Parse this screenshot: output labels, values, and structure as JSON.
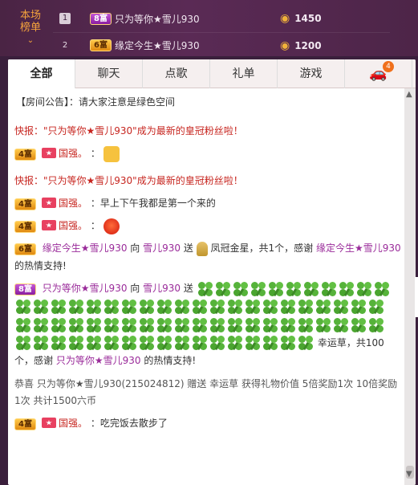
{
  "ranking": {
    "label_line1": "本场",
    "label_line2": "榜单",
    "rows": [
      {
        "rank": "1",
        "badge": "8富",
        "name": "只为等你★雪儿930",
        "score": "1450"
      },
      {
        "rank": "2",
        "badge": "6富",
        "name": "缘定今生★雪儿930",
        "score": "1200"
      }
    ]
  },
  "tabs": [
    {
      "label": "全部"
    },
    {
      "label": "聊天"
    },
    {
      "label": "点歌"
    },
    {
      "label": "礼单"
    },
    {
      "label": "游戏"
    },
    {
      "label": "",
      "badge": "4"
    }
  ],
  "notice": "【房间公告】：请大家注意是绿色空间",
  "messages": {
    "flash1": "快报：\"只为等你★雪儿930\"成为最新的皇冠粉丝啦！",
    "m1_badge": "4富",
    "m1_user": "国强。",
    "m1_sep": "：",
    "flash2": "快报：\"只为等你★雪儿930\"成为最新的皇冠粉丝啦！",
    "m2_badge": "4富",
    "m2_user": "国强。",
    "m2_text": "：早上下午我都是第一个来的",
    "m3_badge": "4富",
    "m3_user": "国强。",
    "m3_sep": "：",
    "gift1_badge": "6富",
    "gift1_from": "缘定今生★雪儿930",
    "gift1_to_prefix": "向",
    "gift1_to": "雪儿930",
    "gift1_send": "送",
    "gift1_desc": "凤冠金星，共1个，感谢",
    "gift1_thanks": "缘定今生★雪儿930",
    "gift1_tail": "的热情支持!",
    "gift2_badge": "8富",
    "gift2_from": "只为等你★雪儿930",
    "gift2_to_prefix": "向",
    "gift2_to": "雪儿930",
    "gift2_send": "送",
    "gift2_desc": "幸运草，共100个，感谢",
    "gift2_thanks": "只为等你★雪儿930",
    "gift2_tail": "的热情支持!",
    "system": "恭喜 只为等你★雪儿930(215024812) 赠送 幸运草 获得礼物价值 5倍奖励1次 10倍奖励1次 共计1500六币",
    "m4_badge": "4富",
    "m4_user": "国强。",
    "m4_text": "：吃完饭去散步了"
  },
  "colors": {
    "accent_red": "#c7251f",
    "accent_purple": "#9a2b9a",
    "rank_gold": "#f4a23c"
  }
}
